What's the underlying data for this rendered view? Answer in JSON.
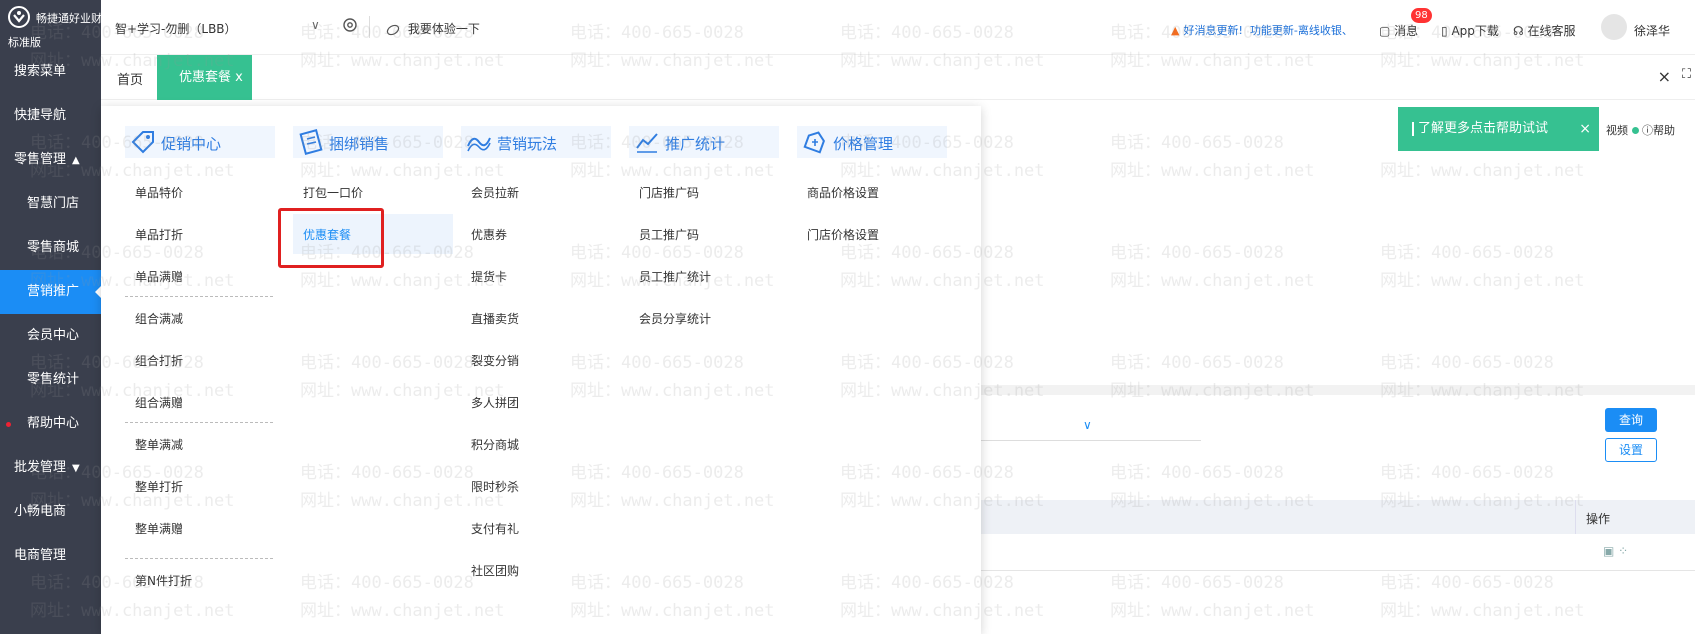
{
  "sidebar": {
    "brand_name": "畅捷通好业财",
    "edition": "标准版",
    "items": [
      {
        "label": "搜索菜单"
      },
      {
        "label": "快捷导航"
      },
      {
        "label": "零售管理",
        "arrow": "▲"
      },
      {
        "label": "智慧门店"
      },
      {
        "label": "零售商城"
      },
      {
        "label": "营销推广"
      },
      {
        "label": "会员中心"
      },
      {
        "label": "零售统计"
      },
      {
        "label": "帮助中心"
      },
      {
        "label": "批发管理",
        "arrow": "▼"
      },
      {
        "label": "小畅电商"
      },
      {
        "label": "电商管理"
      }
    ]
  },
  "topbar": {
    "company": "智+学习-勿删（LBB）",
    "try_label": "我要体验一下",
    "notice_a": "好消息更新!",
    "notice_b": "功能更新-离线收银、",
    "messages": "消息",
    "message_count": "98",
    "app_download": "App下载",
    "online_service": "在线客服",
    "user": "徐泽华"
  },
  "tabs": {
    "home": "首页",
    "active": "优惠套餐",
    "close_all": "×",
    "fullscreen": "⛶"
  },
  "toast": {
    "text": "了解更多点击帮助试试",
    "close": "×"
  },
  "right_tools": {
    "video": "视频",
    "help": "帮助"
  },
  "content": {
    "query": "查询",
    "settings": "设置",
    "operation": "操作"
  },
  "mega_menu": {
    "columns": [
      {
        "title": "促销中心",
        "items": [
          "单品特价",
          "单品打折",
          "单品满赠",
          "组合满减",
          "组合打折",
          "组合满赠",
          "整单满减",
          "整单打折",
          "整单满赠",
          "第N件打折"
        ]
      },
      {
        "title": "捆绑销售",
        "items": [
          "打包一口价",
          "优惠套餐"
        ]
      },
      {
        "title": "营销玩法",
        "items": [
          "会员拉新",
          "优惠券",
          "提货卡",
          "直播卖货",
          "裂变分销",
          "多人拼团",
          "积分商城",
          "限时秒杀",
          "支付有礼",
          "社区团购"
        ]
      },
      {
        "title": "推广统计",
        "items": [
          "门店推广码",
          "员工推广码",
          "员工推广统计",
          "会员分享统计"
        ]
      },
      {
        "title": "价格管理",
        "items": [
          "商品价格设置",
          "门店价格设置"
        ]
      }
    ]
  },
  "watermark": {
    "phone": "电话：400-665-0028",
    "site": "网址：www.chanjet.net"
  },
  "colors": {
    "sidebar_bg": "#3a3f4d",
    "active_blue": "#1b8df5",
    "tab_green": "#36c191",
    "highlight_red": "#e02020"
  }
}
